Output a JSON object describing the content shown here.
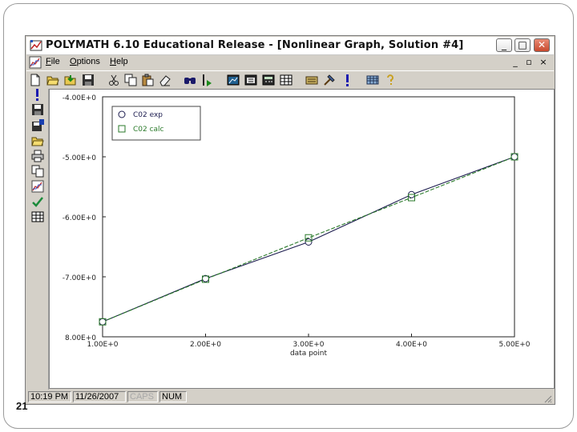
{
  "slide": {
    "number": "21"
  },
  "window": {
    "title": "POLYMATH 6.10 Educational Release - [Nonlinear Graph, Solution #4]",
    "controls": {
      "minimize": "_",
      "maximize": "□",
      "close": "✕"
    }
  },
  "menubar": {
    "items": [
      "File",
      "Options",
      "Help"
    ],
    "mdi_controls": {
      "minimize": "_",
      "restore": "▫",
      "close": "×"
    }
  },
  "toolbar": {
    "icons": [
      "new-file-icon",
      "open-folder-icon",
      "import-icon",
      "save-icon",
      "cut-icon",
      "copy-icon",
      "paste-icon",
      "eraser-icon",
      "find-icon",
      "go-to-icon",
      "graph-window-icon",
      "solve-window-icon",
      "calculator-icon",
      "table-icon",
      "keyboard-icon",
      "tool-hammer-icon",
      "exclamation-icon",
      "grid-icon",
      "help-icon"
    ]
  },
  "sidebar": {
    "icons": [
      "solve-exclamation-icon",
      "save-icon",
      "save-as-icon",
      "open-folder-icon",
      "print-icon",
      "copy-icon",
      "graph-icon",
      "check-icon",
      "table-icon"
    ]
  },
  "statusbar": {
    "time": "10:19 PM",
    "date": "11/26/2007",
    "caps": "CAPS",
    "num": "NUM"
  },
  "colors": {
    "experimental_series": "#1a1a4d",
    "calculated_series": "#2a7a2a",
    "window_face": "#d4d0c8"
  },
  "chart_data": {
    "type": "line",
    "title": "",
    "xlabel": "data point",
    "ylabel": "",
    "x": [
      1,
      2,
      3,
      4,
      5
    ],
    "xlim": [
      1,
      5
    ],
    "ylim": [
      -8.0,
      -4.0
    ],
    "y_inverted": true,
    "xticks": [
      1,
      2,
      3,
      4,
      5
    ],
    "xtick_labels": [
      "1.00E+0",
      "2.00E+0",
      "3.00E+0",
      "4.00E+0",
      "5.00E+0"
    ],
    "yticks": [
      -4.0,
      -5.0,
      -6.0,
      -7.0,
      -8.0
    ],
    "ytick_labels": [
      "-4.00E+0",
      "-5.00E+0",
      "-6.00E+0",
      "-7.00E+0",
      "8.00E+0"
    ],
    "grid": false,
    "legend_position": "top-left",
    "series": [
      {
        "name": "C02 exp",
        "marker": "circle",
        "color": "#1a1a4d",
        "values": [
          -7.75,
          -7.03,
          -6.42,
          -5.63,
          -5.0
        ]
      },
      {
        "name": "C02 calc",
        "marker": "square",
        "color": "#2a7a2a",
        "values": [
          -7.75,
          -7.04,
          -6.35,
          -5.68,
          -5.0
        ]
      }
    ]
  }
}
